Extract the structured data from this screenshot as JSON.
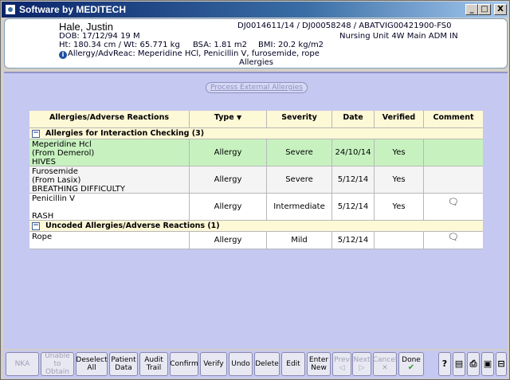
{
  "window": {
    "title": "Software by MEDITECH",
    "controls": {
      "minimize": "_",
      "maximize": "□",
      "close": "X"
    }
  },
  "patient": {
    "name": "Hale, Justin",
    "dob": "DOB: 17/12/94 19 M",
    "vitals": "Ht: 180.34 cm / Wt: 65.771 kg",
    "bsa": "BSA: 1.81 m2",
    "bmi": "BMI: 20.2 kg/m2",
    "allergy_line": "Allergy/AdvReac: Meperidine HCl, Penicillin V, furosemide, rope",
    "allergy_line2": "Allergies",
    "ids": "DJ0014611/14 / DJ00058248 / ABATVIG00421900-FS0",
    "location": "Nursing Unit 4W Main ADM IN"
  },
  "main": {
    "process_button": "Process External Allergies"
  },
  "grid": {
    "headers": [
      "Allergies/Adverse Reactions",
      "Type",
      "Severity",
      "Date",
      "Verified",
      "Comment"
    ],
    "sort_indicator": "▼",
    "groups": [
      {
        "label": "Allergies for Interaction Checking (3)",
        "toggle": "−",
        "rows": [
          {
            "lines": [
              "Meperidine Hcl",
              "(From Demerol)",
              "HIVES"
            ],
            "type": "Allergy",
            "severity": "Severe",
            "date": "24/10/14",
            "verified": "Yes",
            "comment": ""
          },
          {
            "lines": [
              "Furosemide",
              "(From Lasix)",
              "BREATHING DIFFICULTY"
            ],
            "type": "Allergy",
            "severity": "Severe",
            "date": "5/12/14",
            "verified": "Yes",
            "comment": ""
          },
          {
            "lines": [
              "Penicillin V",
              "",
              "RASH"
            ],
            "type": "Allergy",
            "severity": "Intermediate",
            "date": "5/12/14",
            "verified": "Yes",
            "comment": "🗨"
          }
        ]
      },
      {
        "label": "Uncoded Allergies/Adverse Reactions (1)",
        "toggle": "−",
        "rows": [
          {
            "lines": [
              "Rope",
              ""
            ],
            "type": "Allergy",
            "severity": "Mild",
            "date": "5/12/14",
            "verified": "",
            "comment": "🗨"
          }
        ]
      }
    ]
  },
  "toolbar": {
    "nka": "NKA",
    "unable_1": "Unable",
    "unable_2": "to Obtain",
    "deselect_1": "Deselect",
    "deselect_2": "All",
    "patient_1": "Patient",
    "patient_2": "Data",
    "audit_1": "Audit",
    "audit_2": "Trail",
    "confirm": "Confirm",
    "verify": "Verify",
    "undo": "Undo",
    "delete": "Delete",
    "edit": "Edit",
    "enter_1": "Enter",
    "enter_2": "New",
    "prev": "Prev",
    "next": "Next",
    "cancel": "Cancel",
    "done": "Done",
    "help": "?"
  }
}
